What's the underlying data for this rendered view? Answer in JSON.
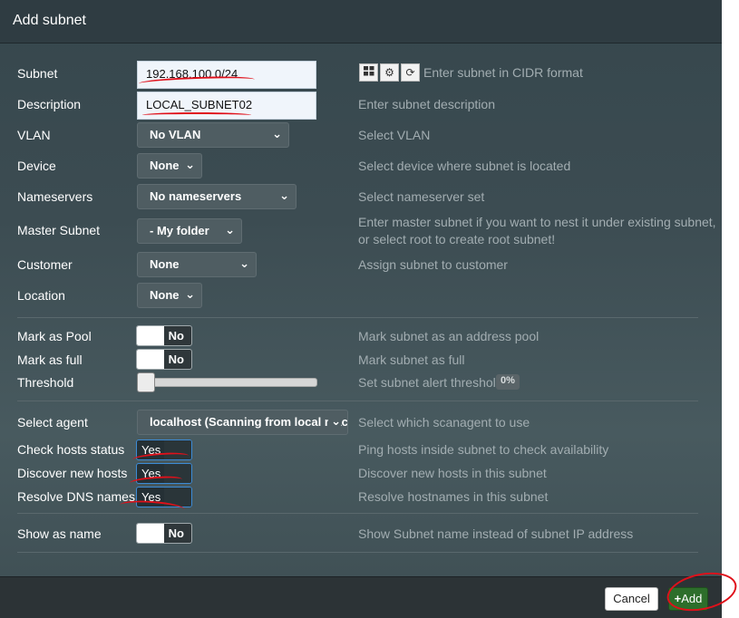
{
  "dialog": {
    "title": "Add subnet"
  },
  "form": {
    "subnet": {
      "label": "Subnet",
      "value": "192.168.100.0/24",
      "hint": "Enter subnet in CIDR format"
    },
    "description": {
      "label": "Description",
      "value": "LOCAL_SUBNET02",
      "hint": "Enter subnet description"
    },
    "vlan": {
      "label": "VLAN",
      "value": "No VLAN",
      "hint": "Select VLAN"
    },
    "device": {
      "label": "Device",
      "value": "None",
      "hint": "Select device where subnet is located"
    },
    "nameservers": {
      "label": "Nameservers",
      "value": "No nameservers",
      "hint": "Select nameserver set"
    },
    "master_subnet": {
      "label": "Master Subnet",
      "value": "- My folder",
      "hint_line1": "Enter master subnet if you want to nest it under existing subnet,",
      "hint_line2": "or select root to create root subnet!"
    },
    "customer": {
      "label": "Customer",
      "value": "None",
      "hint": "Assign subnet to customer"
    },
    "location": {
      "label": "Location",
      "value": "None"
    },
    "mark_pool": {
      "label": "Mark as Pool",
      "value": "No",
      "hint": "Mark subnet as an address pool"
    },
    "mark_full": {
      "label": "Mark as full",
      "value": "No",
      "hint": "Mark subnet as full"
    },
    "threshold": {
      "label": "Threshold",
      "hint": "Set subnet alert threshold",
      "value": "0%",
      "level": 0
    },
    "agent": {
      "label": "Select agent",
      "value": "localhost (Scanning from local mach",
      "hint": "Select which scanagent to use"
    },
    "check_hosts": {
      "label": "Check hosts status",
      "value": "Yes",
      "hint": "Ping hosts inside subnet to check availability"
    },
    "discover_hosts": {
      "label": "Discover new hosts",
      "value": "Yes",
      "hint": "Discover new hosts in this subnet"
    },
    "resolve_dns": {
      "label": "Resolve DNS names",
      "value": "Yes",
      "hint": "Resolve hostnames in this subnet"
    },
    "show_name": {
      "label": "Show as name",
      "value": "No",
      "hint": "Show Subnet name instead of subnet IP address"
    }
  },
  "icons": {
    "grid": "grid-icon",
    "cogs": "cogs-icon",
    "refresh": "refresh-icon",
    "chevron": "chevron-down-icon"
  },
  "footer": {
    "cancel_label": "Cancel",
    "add_label": "Add"
  },
  "colors": {
    "annotation": "#e0101a",
    "add_button": "#2d6e2b",
    "toggle_focus": "#3c8bd6"
  }
}
